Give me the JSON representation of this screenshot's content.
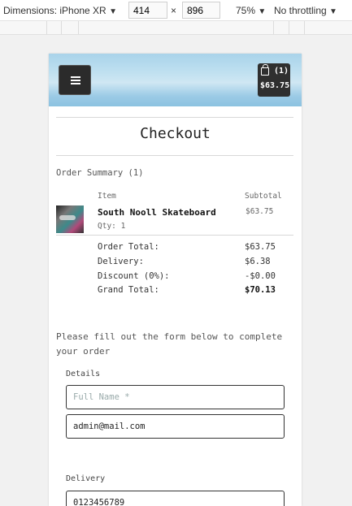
{
  "devtools": {
    "device_label": "Dimensions: iPhone XR",
    "device_caret": "▼",
    "width_value": "414",
    "times": "×",
    "height_value": "896",
    "zoom_label": "75%",
    "zoom_caret": "▼",
    "throttle_label": "No throttling",
    "throttle_caret": "▼"
  },
  "header": {
    "menu_icon": "hamburger-icon",
    "cart_icon": "shopping-bag-icon",
    "cart_count": "(1)",
    "cart_total": "$63.75"
  },
  "page": {
    "title": "Checkout"
  },
  "summary": {
    "heading": "Order Summary (1)",
    "col_item": "Item",
    "col_subtotal": "Subtotal",
    "item": {
      "name": "South Nooll Skateboard",
      "qty": "Qty: 1",
      "subtotal": "$63.75"
    },
    "totals": [
      {
        "label": "Order Total:",
        "value": "$63.75"
      },
      {
        "label": "Delivery:",
        "value": "$6.38"
      },
      {
        "label": "Discount (0%):",
        "value": "-$0.00"
      },
      {
        "label": "Grand Total:",
        "value": "$70.13"
      }
    ]
  },
  "form": {
    "intro": "Please fill out the form below to complete your order",
    "details_label": "Details",
    "full_name_placeholder": "Full Name *",
    "email_value": "admin@mail.com",
    "delivery_label": "Delivery",
    "phone_value": "0123456789"
  },
  "colors": {
    "header_gradient": "#a9d3ea",
    "button_dark": "#2b2b2b"
  }
}
